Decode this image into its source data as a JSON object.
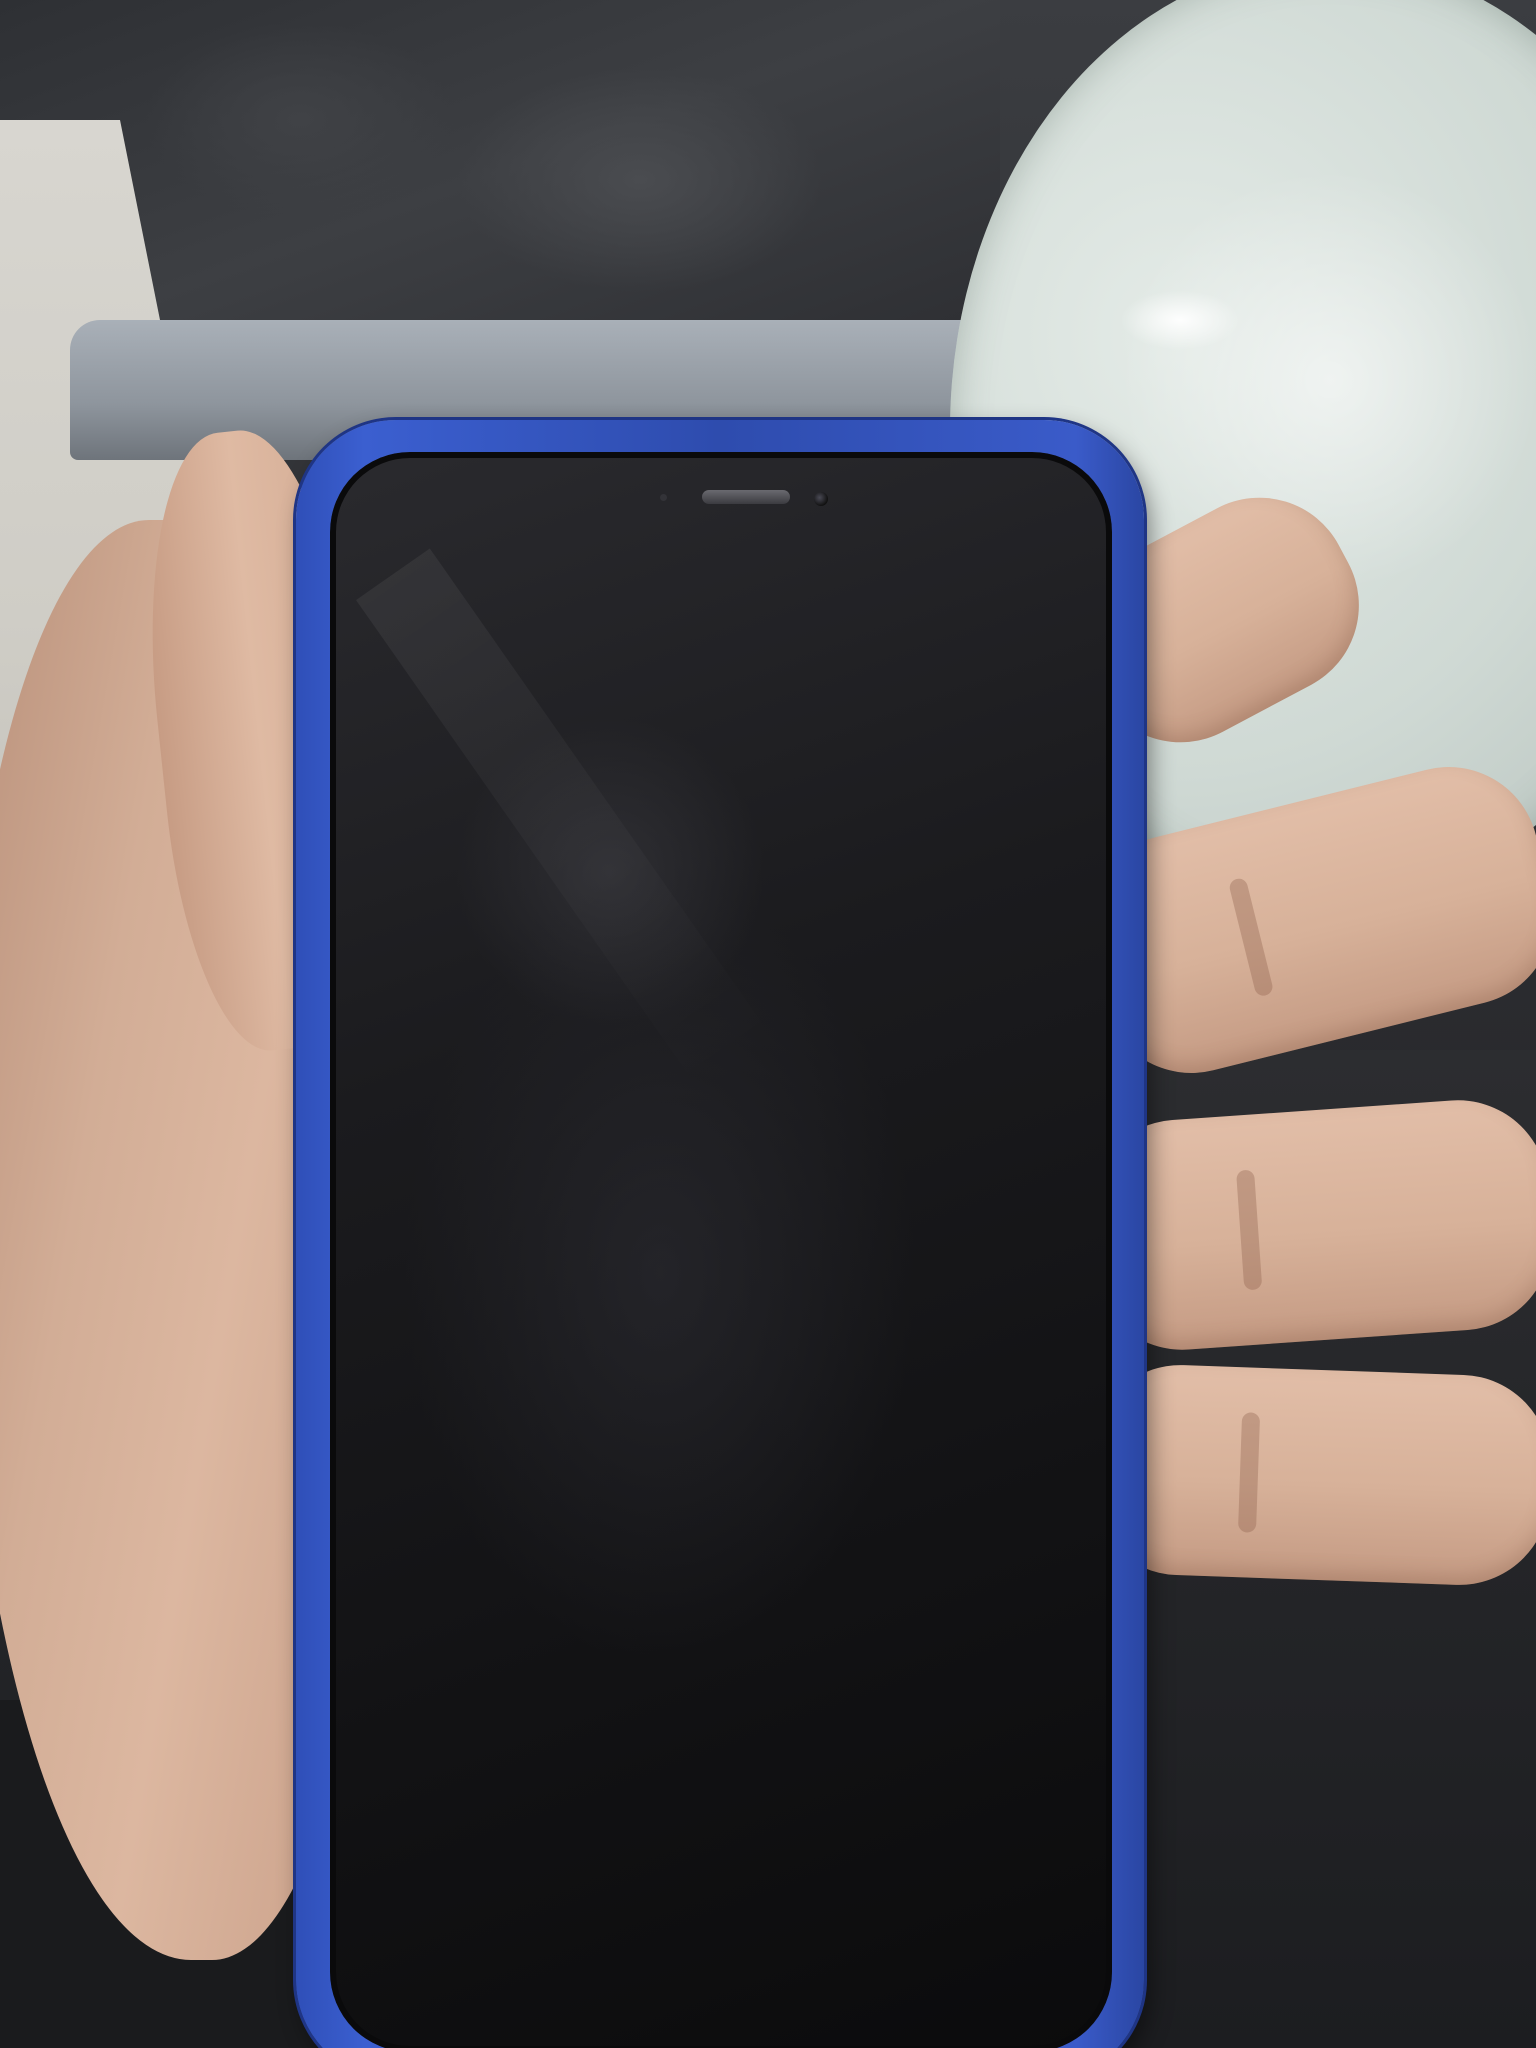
{
  "scene": {
    "subject": "phone",
    "screen_state": "off"
  },
  "colors": {
    "case": "#3352c0",
    "screen": "#121214",
    "skin": "#d7b199",
    "table": "#d6ded9",
    "background": "#2f3034"
  },
  "icons": {
    "earpiece": "earpiece-icon",
    "front_camera": "front-camera-icon"
  }
}
